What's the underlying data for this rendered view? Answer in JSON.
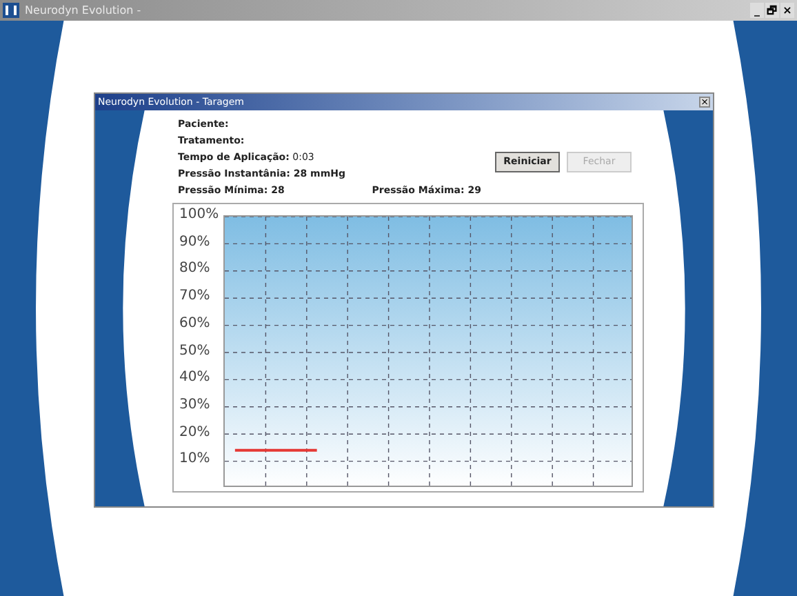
{
  "window": {
    "title": "Neurodyn Evolution -",
    "controls": [
      "_",
      "🗗",
      "×"
    ]
  },
  "dialog": {
    "title": "Neurodyn Evolution - Taragem",
    "close": "×",
    "fields": [
      {
        "label": "Paciente:"
      },
      {
        "label": "Tratamento:"
      },
      {
        "label": "Tempo de Aplicação:",
        "value": "0:03"
      },
      {
        "label": "Pressão Instantânia: 28 mmHg"
      }
    ],
    "min": "Pressão Mínima: 28",
    "max": "Pressão Máxima: 29",
    "buttons": [
      {
        "label": "Reiniciar",
        "disabled": false
      },
      {
        "label": "Fechar",
        "disabled": true
      }
    ],
    "chart_data": {
      "type": "line",
      "grid": true,
      "categories": [
        null,
        null,
        null,
        null,
        null,
        null,
        null,
        null,
        null,
        null,
        null,
        null,
        null,
        null,
        null,
        null,
        null,
        null,
        null,
        null
      ],
      "ylim": [
        0,
        100
      ],
      "yticks": [
        {
          "value": 10,
          "label": "10%"
        },
        {
          "value": 20,
          "label": "20%"
        },
        {
          "value": 30,
          "label": "30%"
        },
        {
          "value": 40,
          "label": "40%"
        },
        {
          "value": 50,
          "label": "50%"
        },
        {
          "value": 60,
          "label": "60%"
        },
        {
          "value": 70,
          "label": "70%"
        },
        {
          "value": 80,
          "label": "80%"
        },
        {
          "value": 90,
          "label": "90%"
        },
        {
          "value": 100,
          "label": "100%"
        }
      ],
      "series": [
        {
          "color": "#e53935",
          "values": [
            14,
            14,
            14,
            14,
            14,
            null,
            null,
            null,
            null,
            null,
            null,
            null,
            null,
            null,
            null,
            null,
            null,
            null,
            null,
            null
          ]
        }
      ]
    }
  }
}
